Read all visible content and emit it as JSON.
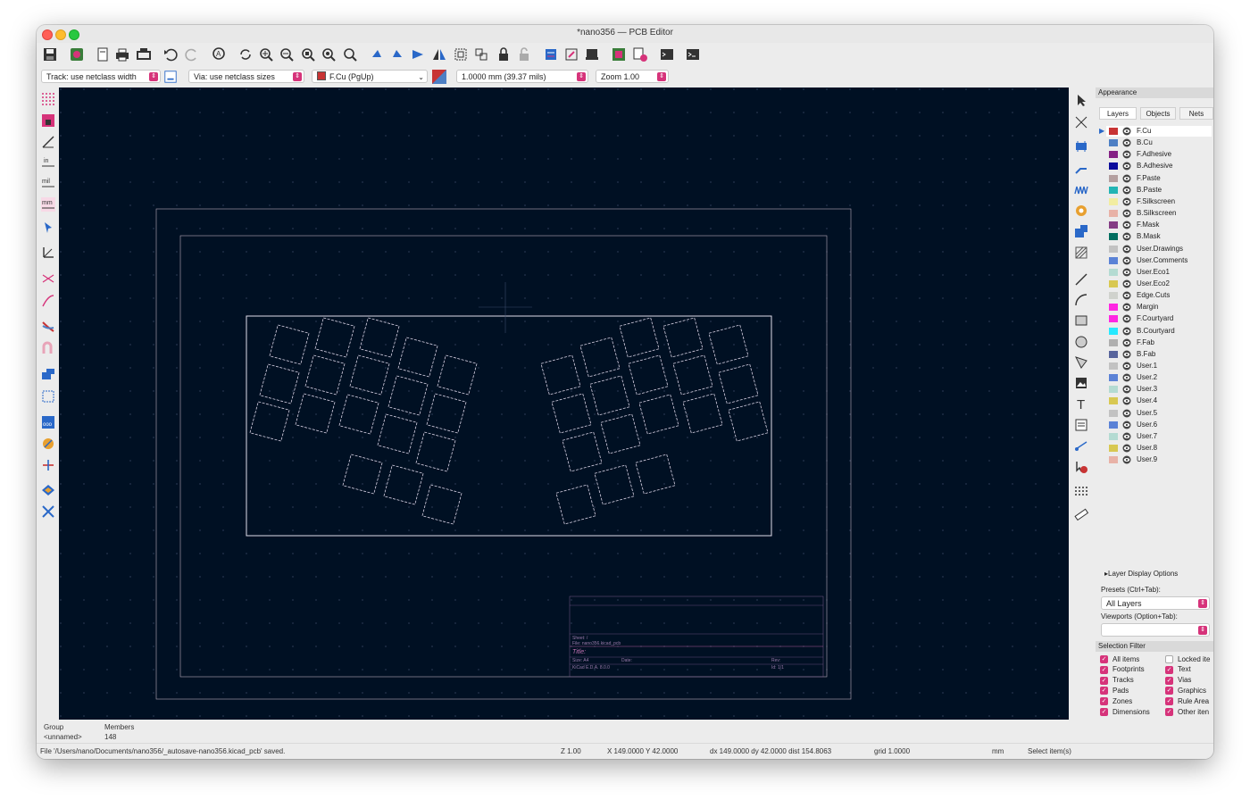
{
  "window": {
    "title": "*nano356 — PCB Editor"
  },
  "toolbar": {
    "icons": [
      "save-icon",
      "board-setup-icon",
      "page-settings-icon",
      "print-icon",
      "plot-icon",
      "undo-icon",
      "redo-icon",
      "find-icon",
      "refresh-icon",
      "zoom-in-icon",
      "zoom-out-icon",
      "zoom-fit-icon",
      "zoom-objects-icon",
      "zoom-selection-icon",
      "rotate-ccw-icon",
      "rotate-cw-icon",
      "flip-icon",
      "mirror-icon",
      "group-icon",
      "ungroup-icon",
      "lock-icon",
      "unlock-icon",
      "netlist-icon",
      "update-pcb-icon",
      "footprint-editor-icon",
      "footprint-browser-icon",
      "drc-icon",
      "scripting-console-icon"
    ]
  },
  "options": {
    "track_width": "Track: use netclass width",
    "via_size": "Via: use netclass sizes",
    "layer": "F.Cu (PgUp)",
    "layer_color": "#c83434",
    "grid": "1.0000 mm (39.37 mils)",
    "zoom": "Zoom 1.00"
  },
  "appearance": {
    "header": "Appearance",
    "tabs": [
      "Layers",
      "Objects",
      "Nets"
    ],
    "layers": [
      {
        "name": "F.Cu",
        "color": "#c83434"
      },
      {
        "name": "B.Cu",
        "color": "#4d7fc4"
      },
      {
        "name": "F.Adhesive",
        "color": "#842184"
      },
      {
        "name": "B.Adhesive",
        "color": "#0c0c9c"
      },
      {
        "name": "F.Paste",
        "color": "#b4a0a0"
      },
      {
        "name": "B.Paste",
        "color": "#23b5b5"
      },
      {
        "name": "F.Silkscreen",
        "color": "#f2eda1"
      },
      {
        "name": "B.Silkscreen",
        "color": "#e8b2a7"
      },
      {
        "name": "F.Mask",
        "color": "#843c84"
      },
      {
        "name": "B.Mask",
        "color": "#026e60"
      },
      {
        "name": "User.Drawings",
        "color": "#c2c2c2"
      },
      {
        "name": "User.Comments",
        "color": "#5b82d6"
      },
      {
        "name": "User.Eco1",
        "color": "#b4dbd2"
      },
      {
        "name": "User.Eco2",
        "color": "#d8c852"
      },
      {
        "name": "Edge.Cuts",
        "color": "#d0d2cd"
      },
      {
        "name": "Margin",
        "color": "#ff26e2"
      },
      {
        "name": "F.Courtyard",
        "color": "#ff26e2"
      },
      {
        "name": "B.Courtyard",
        "color": "#26e9ff"
      },
      {
        "name": "F.Fab",
        "color": "#afafaf"
      },
      {
        "name": "B.Fab",
        "color": "#58649c"
      },
      {
        "name": "User.1",
        "color": "#c2c2c2"
      },
      {
        "name": "User.2",
        "color": "#5b82d6"
      },
      {
        "name": "User.3",
        "color": "#b4dbd2"
      },
      {
        "name": "User.4",
        "color": "#d8c852"
      },
      {
        "name": "User.5",
        "color": "#c2c2c2"
      },
      {
        "name": "User.6",
        "color": "#5b82d6"
      },
      {
        "name": "User.7",
        "color": "#b4dbd2"
      },
      {
        "name": "User.8",
        "color": "#d8c852"
      },
      {
        "name": "User.9",
        "color": "#e8b2a7"
      }
    ],
    "layer_display_options": "Layer Display Options",
    "presets_label": "Presets (Ctrl+Tab):",
    "presets_value": "All Layers",
    "viewports_label": "Viewports (Option+Tab):",
    "viewports_value": ""
  },
  "selection_filter": {
    "header": "Selection Filter",
    "items": [
      {
        "label": "All items",
        "checked": true
      },
      {
        "label": "Locked ite",
        "checked": false
      },
      {
        "label": "Footprints",
        "checked": true
      },
      {
        "label": "Text",
        "checked": true
      },
      {
        "label": "Tracks",
        "checked": true
      },
      {
        "label": "Vias",
        "checked": true
      },
      {
        "label": "Pads",
        "checked": true
      },
      {
        "label": "Graphics",
        "checked": true
      },
      {
        "label": "Zones",
        "checked": true
      },
      {
        "label": "Rule Area",
        "checked": true
      },
      {
        "label": "Dimensions",
        "checked": true
      },
      {
        "label": "Other iten",
        "checked": true
      }
    ]
  },
  "message_panel": {
    "col1_header": "Group",
    "col1_value": "<unnamed>",
    "col2_header": "Members",
    "col2_value": "148"
  },
  "status": {
    "message": "File '/Users/nano/Documents/nano356/_autosave-nano356.kicad_pcb' saved.",
    "zoom": "Z 1.00",
    "cursor": "X 149.0000  Y 42.0000",
    "delta": "dx 149.0000  dy 42.0000  dist 154.8063",
    "grid": "grid 1.0000",
    "units": "mm",
    "mode": "Select item(s)"
  },
  "titleblock": {
    "sheet": "Sheet: /",
    "file": "File: nano356.kicad_pcb",
    "title": "Title:",
    "size": "Size: A4",
    "date": "Date:",
    "rev": "Rev:",
    "kicad": "KiCad E.D.A. 8.0.0",
    "id": "Id: 1/1"
  }
}
